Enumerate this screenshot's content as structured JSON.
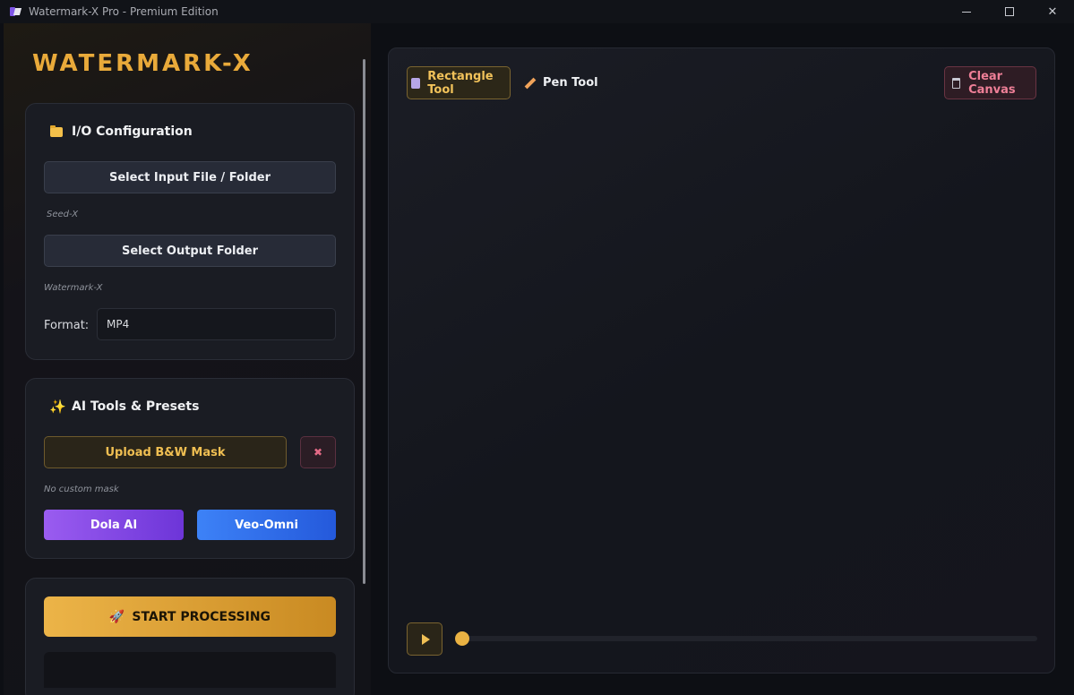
{
  "window": {
    "title": "Watermark-X Pro - Premium Edition",
    "controls": {
      "minimize": "minimize",
      "maximize": "maximize",
      "close": "✕"
    }
  },
  "sidebar": {
    "brand": "WATERMARK-X",
    "io": {
      "title": "I/O Configuration",
      "input_button": "Select Input File / Folder",
      "input_path": "Seed-X",
      "output_button": "Select Output Folder",
      "output_path": "Watermark-X",
      "format_label": "Format:",
      "format_value": "MP4"
    },
    "ai": {
      "title": "AI Tools & Presets",
      "upload_mask_button": "Upload B&W Mask",
      "clear_mask_button": "✖",
      "mask_status": "No custom mask",
      "dola_button": "Dola AI",
      "veo_button": "Veo-Omni"
    },
    "process": {
      "start_button": "START PROCESSING",
      "start_icon": "🚀"
    }
  },
  "canvas": {
    "tools": {
      "rectangle": "Rectangle Tool",
      "pen": "Pen Tool",
      "clear": "Clear Canvas"
    },
    "timeline": {
      "position": 0
    }
  },
  "colors": {
    "accent": "#e9aa3a",
    "dola": "#8a4ee8",
    "veo": "#3470ee",
    "danger": "#ee7f97"
  }
}
